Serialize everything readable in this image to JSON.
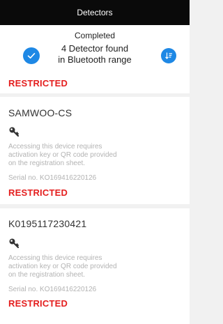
{
  "header": {
    "title": "Detectors"
  },
  "status": {
    "state": "Completed",
    "found_line1": "4 Detector found",
    "found_line2": "in Bluetooth range"
  },
  "colors": {
    "accent": "#1e88e5",
    "restricted": "#e41e1e",
    "topbar": "#0a0a0a"
  },
  "detectors": [
    {
      "restricted_label": "RESTRICTED"
    },
    {
      "name": "SAMWOO-CS",
      "desc_line1": "Accessing this device requires",
      "desc_line2": "activation key or QR code provided",
      "desc_line3": "on the registration sheet.",
      "serial": "Serial no. KO169416220126",
      "restricted_label": "RESTRICTED",
      "icon": "key-icon"
    },
    {
      "name": "K0195117230421",
      "desc_line1": "Accessing this device requires",
      "desc_line2": "activation key or QR code provided",
      "desc_line3": "on the registration sheet.",
      "serial": "Serial no. KO169416220126",
      "restricted_label": "RESTRICTED",
      "icon": "key-icon"
    }
  ]
}
